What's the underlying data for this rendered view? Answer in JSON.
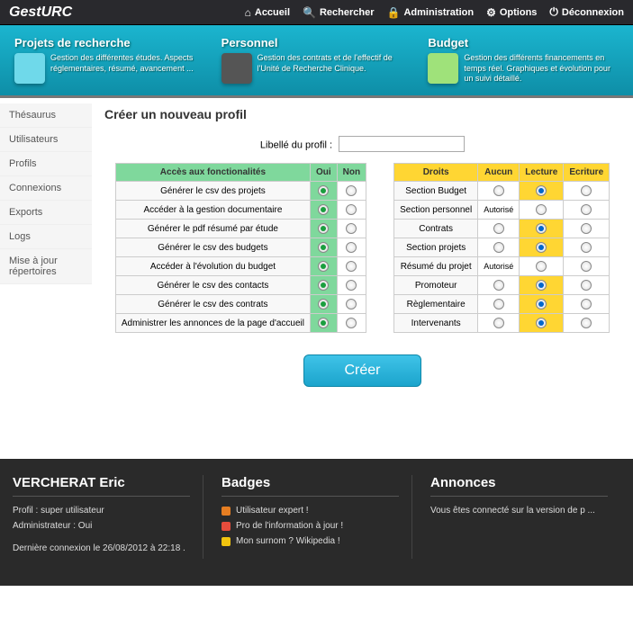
{
  "app": {
    "name": "GestURC"
  },
  "nav": {
    "accueil": "Accueil",
    "rechercher": "Rechercher",
    "admin": "Administration",
    "options": "Options",
    "deconnexion": "Déconnexion"
  },
  "banner": {
    "projets": {
      "title": "Projets de recherche",
      "desc": "Gestion des différentes études. Aspects réglementaires, résumé, avancement ..."
    },
    "personnel": {
      "title": "Personnel",
      "desc": "Gestion des contrats et de l'effectif de l'Unité de Recherche Clinique."
    },
    "budget": {
      "title": "Budget",
      "desc": "Gestion des différents financements en temps réel. Graphiques et évolution pour un suivi détaillé."
    }
  },
  "sidebar": [
    "Thésaurus",
    "Utilisateurs",
    "Profils",
    "Connexions",
    "Exports",
    "Logs",
    "Mise à jour répertoires"
  ],
  "page": {
    "title": "Créer un nouveau profil",
    "libelle_label": "Libellé du profil :",
    "create": "Créer"
  },
  "func": {
    "header": "Accès aux fonctionalités",
    "oui": "Oui",
    "non": "Non",
    "rows": [
      "Générer le csv des projets",
      "Accéder à la gestion documentaire",
      "Générer le pdf résumé par étude",
      "Générer le csv des budgets",
      "Accéder à l'évolution du budget",
      "Générer le csv des contacts",
      "Générer le csv des contrats",
      "Administrer les annonces de la page d'accueil"
    ]
  },
  "droits": {
    "header": "Droits",
    "aucun": "Aucun",
    "lecture": "Lecture",
    "ecriture": "Ecriture",
    "rows": [
      {
        "label": "Section Budget",
        "sel": "lecture"
      },
      {
        "label": "Section personnel",
        "sel": "auth",
        "auth": "Autorisé"
      },
      {
        "label": "Contrats",
        "sel": "lecture"
      },
      {
        "label": "Section projets",
        "sel": "lecture"
      },
      {
        "label": "Résumé du projet",
        "sel": "auth",
        "auth": "Autorisé"
      },
      {
        "label": "Promoteur",
        "sel": "lecture"
      },
      {
        "label": "Règlementaire",
        "sel": "lecture"
      },
      {
        "label": "Intervenants",
        "sel": "lecture"
      }
    ]
  },
  "footer": {
    "user": {
      "name": "VERCHERAT Eric",
      "profil": "Profil : super utilisateur",
      "admin": "Administrateur : Oui",
      "last": "Dernière connexion le 26/08/2012 à 22:18 ."
    },
    "badges": {
      "title": "Badges",
      "items": [
        "Utilisateur expert !",
        "Pro de l'information à jour !",
        "Mon surnom ? Wikipedia !"
      ],
      "colors": [
        "#e67e22",
        "#e74c3c",
        "#f1c40f"
      ]
    },
    "annonces": {
      "title": "Annonces",
      "text": "Vous êtes connecté sur la version de p ..."
    }
  }
}
